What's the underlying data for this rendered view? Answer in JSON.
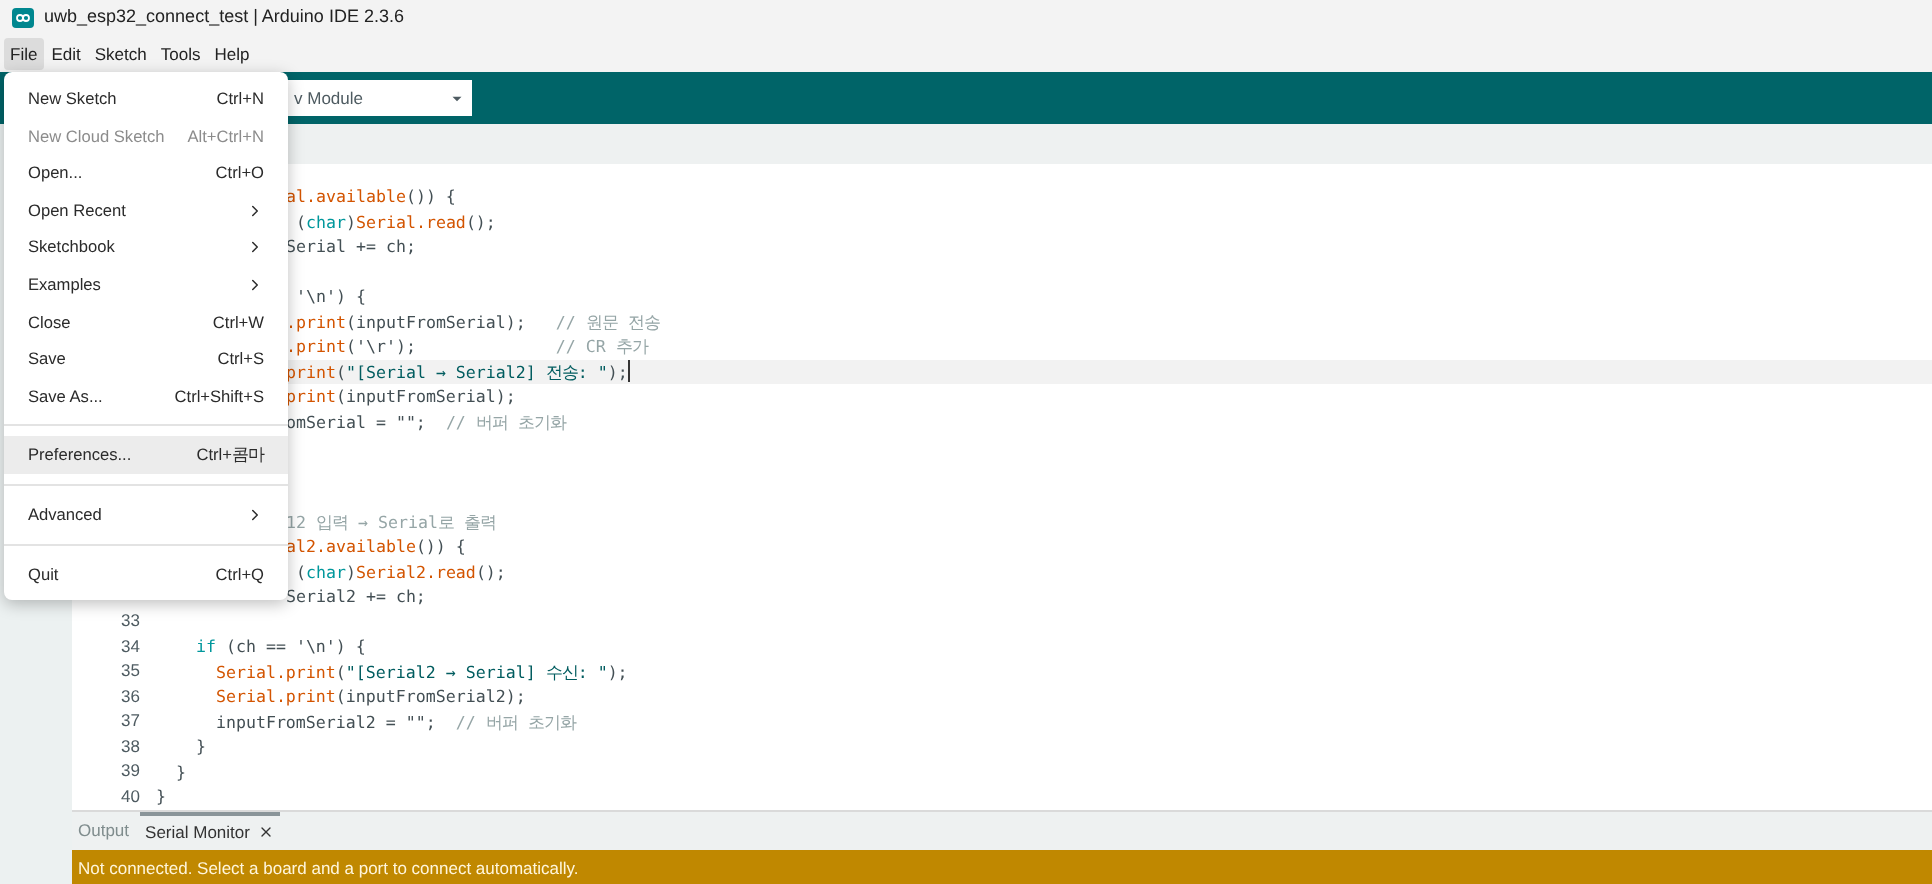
{
  "window": {
    "title": "uwb_esp32_connect_test | Arduino IDE 2.3.6"
  },
  "menubar": [
    {
      "label": "File",
      "selected": true
    },
    {
      "label": "Edit",
      "selected": false
    },
    {
      "label": "Sketch",
      "selected": false
    },
    {
      "label": "Tools",
      "selected": false
    },
    {
      "label": "Help",
      "selected": false
    }
  ],
  "toolbar": {
    "board_dropdown": {
      "value": "v Module"
    }
  },
  "file_menu": [
    {
      "kind": "item",
      "label": "New Sketch",
      "shortcut": "Ctrl+N",
      "disabled": false,
      "selected": false,
      "submenu": false
    },
    {
      "kind": "item",
      "label": "New Cloud Sketch",
      "shortcut": "Alt+Ctrl+N",
      "disabled": true,
      "selected": false,
      "submenu": false
    },
    {
      "kind": "item",
      "label": "Open...",
      "shortcut": "Ctrl+O",
      "disabled": false,
      "selected": false,
      "submenu": false
    },
    {
      "kind": "item",
      "label": "Open Recent",
      "disabled": false,
      "selected": false,
      "submenu": true
    },
    {
      "kind": "item",
      "label": "Sketchbook",
      "disabled": false,
      "selected": false,
      "submenu": true
    },
    {
      "kind": "item",
      "label": "Examples",
      "disabled": false,
      "selected": false,
      "submenu": true
    },
    {
      "kind": "item",
      "label": "Close",
      "shortcut": "Ctrl+W",
      "disabled": false,
      "selected": false,
      "submenu": false
    },
    {
      "kind": "item",
      "label": "Save",
      "shortcut": "Ctrl+S",
      "disabled": false,
      "selected": false,
      "submenu": false
    },
    {
      "kind": "item",
      "label": "Save As...",
      "shortcut": "Ctrl+Shift+S",
      "disabled": false,
      "selected": false,
      "submenu": false
    },
    {
      "kind": "separator"
    },
    {
      "kind": "item",
      "label": "Preferences...",
      "shortcut": "Ctrl+콤마",
      "disabled": false,
      "selected": true,
      "submenu": false
    },
    {
      "kind": "separator"
    },
    {
      "kind": "item",
      "label": "Advanced",
      "disabled": false,
      "selected": false,
      "submenu": true
    },
    {
      "kind": "separator"
    },
    {
      "kind": "item",
      "label": "Quit",
      "shortcut": "Ctrl+Q",
      "disabled": false,
      "selected": false,
      "submenu": false
    }
  ],
  "editor": {
    "lines": [
      {
        "kind": "partial",
        "current": false,
        "segments": [
          {
            "text": "al.available",
            "kind": "function"
          },
          {
            "text": "()) {",
            "kind": "plain"
          }
        ]
      },
      {
        "kind": "partial",
        "current": false,
        "segments": [
          {
            "text": " (",
            "kind": "plain"
          },
          {
            "text": "char",
            "kind": "keyword"
          },
          {
            "text": ")",
            "kind": "plain"
          },
          {
            "text": "Serial.read",
            "kind": "function"
          },
          {
            "text": "();",
            "kind": "plain"
          }
        ]
      },
      {
        "kind": "partial",
        "current": false,
        "segments": [
          {
            "text": "Serial += ch;",
            "kind": "plain"
          }
        ]
      },
      {
        "kind": "partial",
        "current": false
      },
      {
        "kind": "partial",
        "current": false,
        "segments": [
          {
            "text": " '\\n') {",
            "kind": "plain"
          }
        ]
      },
      {
        "kind": "partial",
        "current": false,
        "segments": [
          {
            "text": ".print",
            "kind": "function"
          },
          {
            "text": "(inputFromSerial);   ",
            "kind": "plain"
          },
          {
            "text": "// 원문 전송",
            "kind": "comment"
          }
        ]
      },
      {
        "kind": "partial",
        "current": false,
        "segments": [
          {
            "text": ".print",
            "kind": "function"
          },
          {
            "text": "('\\r');              ",
            "kind": "plain"
          },
          {
            "text": "// CR 추가",
            "kind": "comment"
          }
        ]
      },
      {
        "kind": "partial",
        "current": true,
        "segments": [
          {
            "text": "print",
            "kind": "function"
          },
          {
            "text": "(",
            "kind": "plain"
          },
          {
            "text": "\"[Serial → Serial2] 전송: \"",
            "kind": "string"
          },
          {
            "text": ");",
            "kind": "plain"
          }
        ]
      },
      {
        "kind": "partial",
        "current": false,
        "segments": [
          {
            "text": "print",
            "kind": "function"
          },
          {
            "text": "(inputFromSerial);",
            "kind": "plain"
          }
        ]
      },
      {
        "kind": "partial",
        "current": false,
        "segments": [
          {
            "text": "omSerial = \"\";  ",
            "kind": "plain"
          },
          {
            "text": "// 버퍼 초기화",
            "kind": "comment"
          }
        ]
      },
      {
        "kind": "partial",
        "current": false
      },
      {
        "kind": "partial",
        "current": false
      },
      {
        "kind": "partial",
        "current": false
      },
      {
        "kind": "partial",
        "current": false,
        "segments": [
          {
            "text": "12 입력 → Serial로 출력",
            "kind": "comment"
          }
        ]
      },
      {
        "kind": "partial",
        "current": false,
        "segments": [
          {
            "text": "al2.available",
            "kind": "function"
          },
          {
            "text": "()) {",
            "kind": "plain"
          }
        ]
      },
      {
        "kind": "partial",
        "current": false,
        "segments": [
          {
            "text": " (",
            "kind": "plain"
          },
          {
            "text": "char",
            "kind": "keyword"
          },
          {
            "text": ")",
            "kind": "plain"
          },
          {
            "text": "Serial2.read",
            "kind": "function"
          },
          {
            "text": "();",
            "kind": "plain"
          }
        ]
      },
      {
        "kind": "partial",
        "current": false,
        "segments": [
          {
            "text": "Serial2 += ch;",
            "kind": "plain"
          }
        ]
      },
      {
        "kind": "full",
        "number": "33",
        "current": false
      },
      {
        "kind": "full",
        "number": "34",
        "current": false,
        "segments": [
          {
            "text": "    if",
            "kind": "keyword"
          },
          {
            "text": " (ch == '\\n') {",
            "kind": "plain"
          }
        ]
      },
      {
        "kind": "full",
        "number": "35",
        "current": false,
        "segments": [
          {
            "text": "      Serial.print",
            "kind": "function"
          },
          {
            "text": "(",
            "kind": "plain"
          },
          {
            "text": "\"[Serial2 → Serial] 수신: \"",
            "kind": "string"
          },
          {
            "text": ");",
            "kind": "plain"
          }
        ]
      },
      {
        "kind": "full",
        "number": "36",
        "current": false,
        "segments": [
          {
            "text": "      Serial.print",
            "kind": "function"
          },
          {
            "text": "(inputFromSerial2);",
            "kind": "plain"
          }
        ]
      },
      {
        "kind": "full",
        "number": "37",
        "current": false,
        "segments": [
          {
            "text": "      inputFromSerial2 = \"\";  ",
            "kind": "plain"
          },
          {
            "text": "// 버퍼 초기화",
            "kind": "comment"
          }
        ]
      },
      {
        "kind": "full",
        "number": "38",
        "current": false,
        "segments": [
          {
            "text": "    }",
            "kind": "plain"
          }
        ]
      },
      {
        "kind": "full",
        "number": "39",
        "current": false,
        "segments": [
          {
            "text": "  }",
            "kind": "plain"
          }
        ]
      },
      {
        "kind": "full",
        "number": "40",
        "current": false,
        "segments": [
          {
            "text": "}",
            "kind": "plain"
          }
        ]
      }
    ]
  },
  "bottom_panel": {
    "tabs": [
      {
        "label": "Output",
        "selected": false,
        "closable": false
      },
      {
        "label": "Serial Monitor",
        "selected": true,
        "closable": true
      }
    ]
  },
  "status_bar": {
    "text": "Not connected. Select a board and a port to connect automatically."
  }
}
